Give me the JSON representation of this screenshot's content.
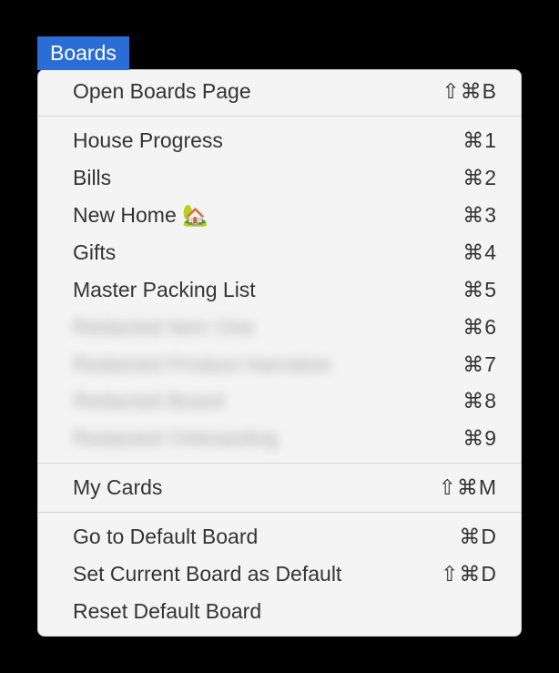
{
  "menu": {
    "title": "Boards",
    "sections": [
      {
        "items": [
          {
            "label": "Open Boards Page",
            "shortcut": "⇧⌘B"
          }
        ]
      },
      {
        "items": [
          {
            "label": "House Progress",
            "shortcut": "⌘1"
          },
          {
            "label": "Bills",
            "shortcut": "⌘2"
          },
          {
            "label": "New Home 🏡",
            "shortcut": "⌘3"
          },
          {
            "label": "Gifts",
            "shortcut": "⌘4"
          },
          {
            "label": "Master Packing List",
            "shortcut": "⌘5"
          },
          {
            "label": "Redacted Item One",
            "shortcut": "⌘6",
            "blurred": true
          },
          {
            "label": "Redacted Product Narrative",
            "shortcut": "⌘7",
            "blurred": true
          },
          {
            "label": "Redacted Board",
            "shortcut": "⌘8",
            "blurred": true
          },
          {
            "label": "Redacted Onboarding",
            "shortcut": "⌘9",
            "blurred": true
          }
        ]
      },
      {
        "items": [
          {
            "label": "My Cards",
            "shortcut": "⇧⌘M"
          }
        ]
      },
      {
        "items": [
          {
            "label": "Go to Default Board",
            "shortcut": "⌘D"
          },
          {
            "label": "Set Current Board as Default",
            "shortcut": "⇧⌘D"
          },
          {
            "label": "Reset Default Board",
            "shortcut": ""
          }
        ]
      }
    ]
  }
}
